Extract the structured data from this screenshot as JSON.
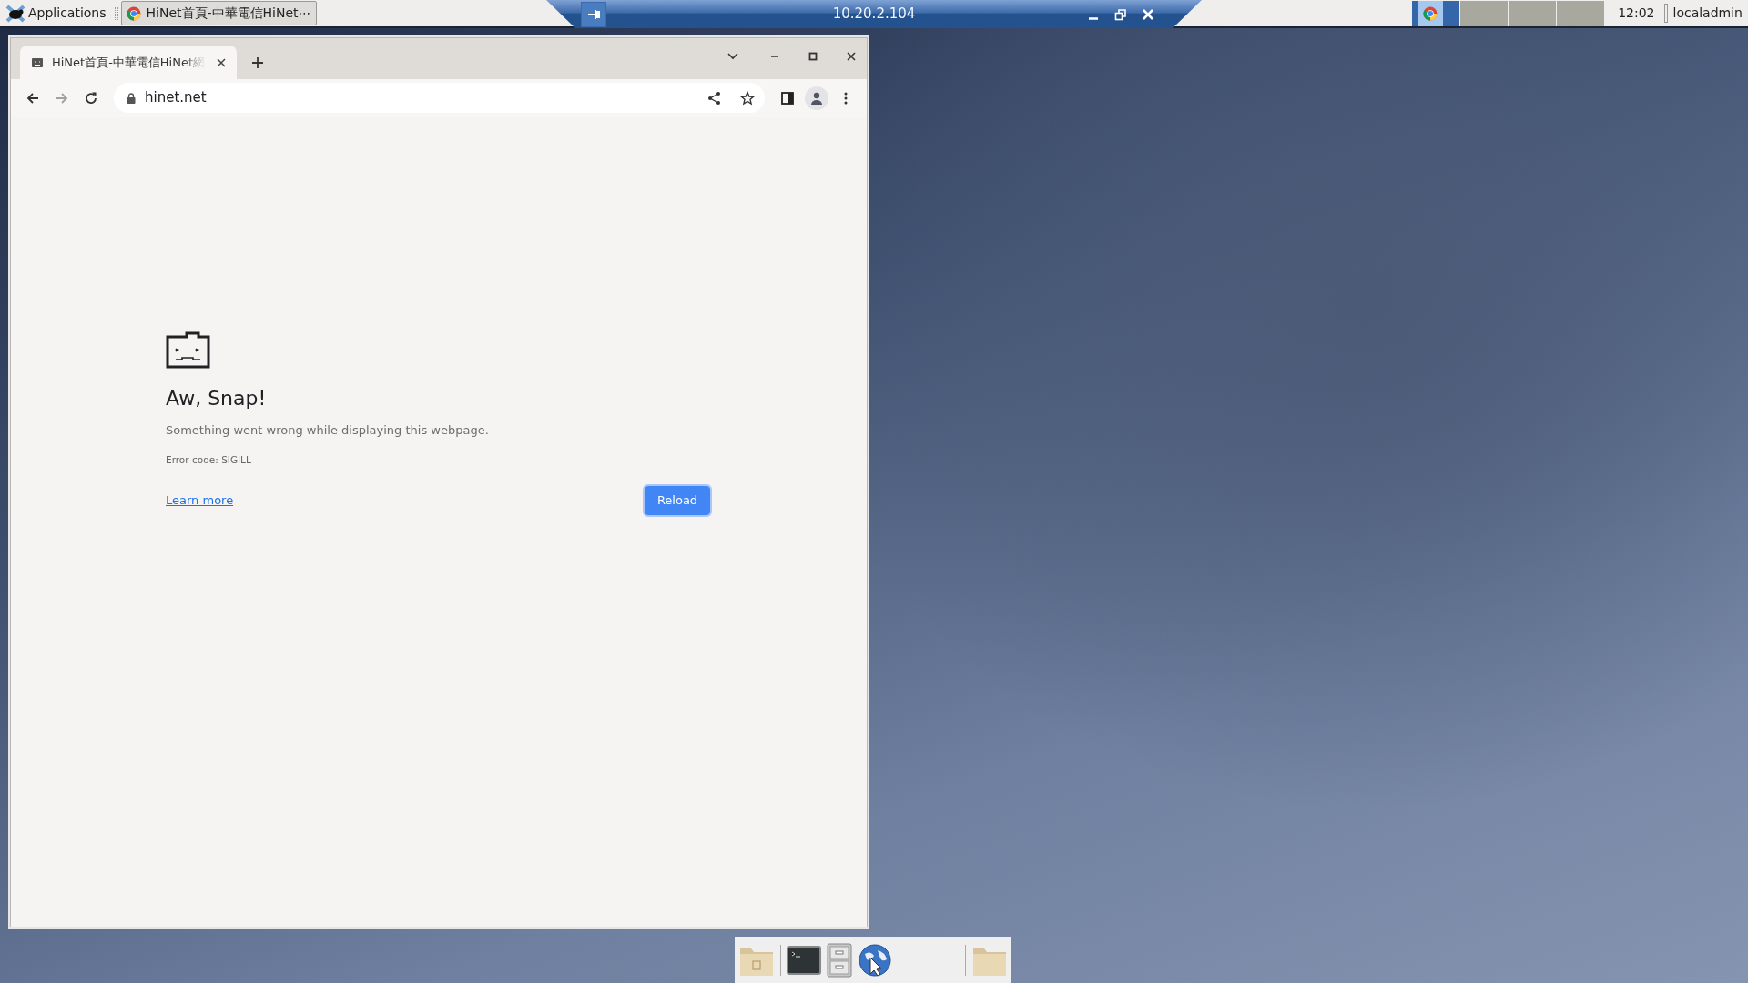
{
  "top_panel": {
    "menu_label": "Applications",
    "task": {
      "title": "HiNet首頁-中華電信HiNet⋯",
      "selected": true
    },
    "workspaces": [
      {
        "selected": true
      },
      {
        "selected": false
      },
      {
        "selected": false
      },
      {
        "selected": false
      }
    ],
    "clock": "12:02",
    "user": "localadmin"
  },
  "remote_bar": {
    "title": "10.20.2.104"
  },
  "browser": {
    "tab": {
      "title": "HiNet首頁-中華電信HiNet網",
      "selected": true
    },
    "nav": {
      "back_disabled": false,
      "forward_disabled": true
    },
    "address": "hinet.net",
    "error": {
      "heading": "Aw, Snap!",
      "message": "Something went wrong while displaying this webpage.",
      "code": "Error code: SIGILL",
      "link": "Learn more",
      "button": "Reload"
    }
  }
}
